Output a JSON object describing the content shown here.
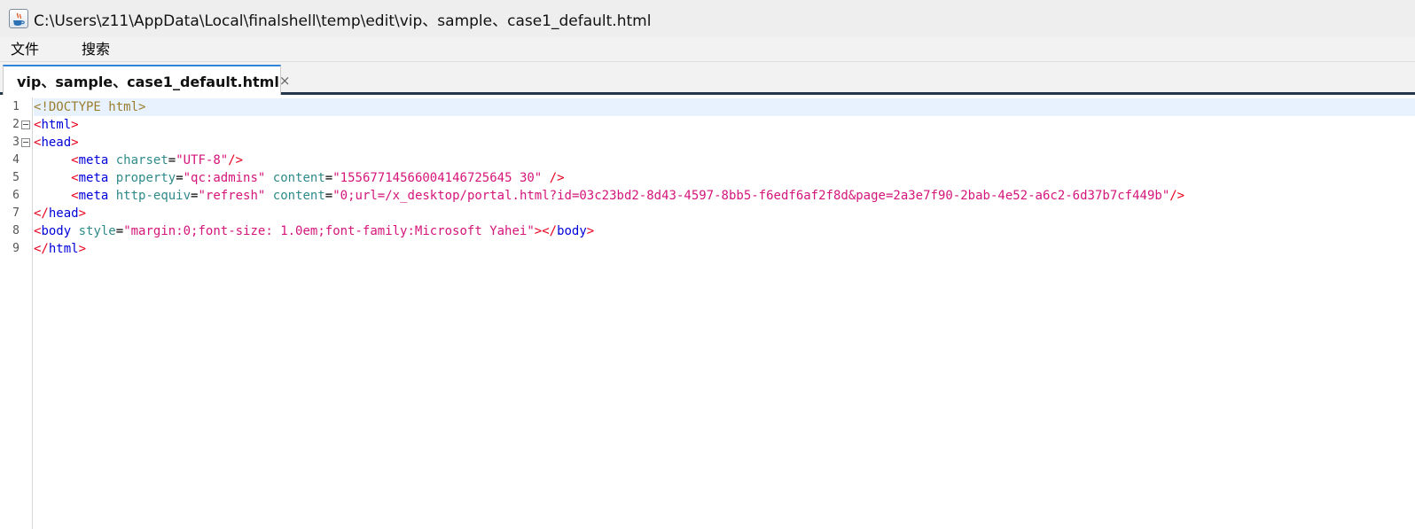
{
  "window": {
    "title": "C:\\Users\\z11\\AppData\\Local\\finalshell\\temp\\edit\\vip、sample、case1_default.html",
    "icon": "java-coffee-cup-icon"
  },
  "menu": {
    "items": [
      {
        "label": "文件"
      },
      {
        "label": "搜索"
      }
    ]
  },
  "tabs": [
    {
      "label": "vip、sample、case1_default.html",
      "close": "×",
      "active": true
    }
  ],
  "colors": {
    "doctype": "#9a7d2e",
    "bracket": "#e8001c",
    "tag": "#0000d8",
    "attr": "#2f8a8a",
    "string": "#d4157a",
    "plain": "#000000",
    "current_line": "#e8f2fe",
    "tab_accent": "#2f86d8"
  },
  "editor": {
    "current_line": 1,
    "lines": [
      {
        "num": "1",
        "fold": false,
        "tokens": [
          {
            "t": "<!DOCTYPE html>",
            "c": "doctype"
          }
        ]
      },
      {
        "num": "2",
        "fold": true,
        "tokens": [
          {
            "t": "<",
            "c": "bracket"
          },
          {
            "t": "html",
            "c": "tag"
          },
          {
            "t": ">",
            "c": "bracket"
          }
        ]
      },
      {
        "num": "3",
        "fold": true,
        "tokens": [
          {
            "t": "<",
            "c": "bracket"
          },
          {
            "t": "head",
            "c": "tag"
          },
          {
            "t": ">",
            "c": "bracket"
          }
        ]
      },
      {
        "num": "4",
        "fold": false,
        "tokens": [
          {
            "t": "     ",
            "c": "plain"
          },
          {
            "t": "<",
            "c": "bracket"
          },
          {
            "t": "meta",
            "c": "tag"
          },
          {
            "t": " ",
            "c": "plain"
          },
          {
            "t": "charset",
            "c": "attr"
          },
          {
            "t": "=",
            "c": "plain"
          },
          {
            "t": "\"UTF-8\"",
            "c": "string"
          },
          {
            "t": "/>",
            "c": "bracket"
          }
        ]
      },
      {
        "num": "5",
        "fold": false,
        "tokens": [
          {
            "t": "     ",
            "c": "plain"
          },
          {
            "t": "<",
            "c": "bracket"
          },
          {
            "t": "meta",
            "c": "tag"
          },
          {
            "t": " ",
            "c": "plain"
          },
          {
            "t": "property",
            "c": "attr"
          },
          {
            "t": "=",
            "c": "plain"
          },
          {
            "t": "\"qc:admins\"",
            "c": "string"
          },
          {
            "t": " ",
            "c": "plain"
          },
          {
            "t": "content",
            "c": "attr"
          },
          {
            "t": "=",
            "c": "plain"
          },
          {
            "t": "\"15567714566004146725645 30\"",
            "c": "string"
          },
          {
            "t": " ",
            "c": "plain"
          },
          {
            "t": "/>",
            "c": "bracket"
          }
        ]
      },
      {
        "num": "6",
        "fold": false,
        "tokens": [
          {
            "t": "     ",
            "c": "plain"
          },
          {
            "t": "<",
            "c": "bracket"
          },
          {
            "t": "meta",
            "c": "tag"
          },
          {
            "t": " ",
            "c": "plain"
          },
          {
            "t": "http-equiv",
            "c": "attr"
          },
          {
            "t": "=",
            "c": "plain"
          },
          {
            "t": "\"refresh\"",
            "c": "string"
          },
          {
            "t": " ",
            "c": "plain"
          },
          {
            "t": "content",
            "c": "attr"
          },
          {
            "t": "=",
            "c": "plain"
          },
          {
            "t": "\"0;url=/x_desktop/portal.html?id=03c23bd2-8d43-4597-8bb5-f6edf6af2f8d&page=2a3e7f90-2bab-4e52-a6c2-6d37b7cf449b\"",
            "c": "string"
          },
          {
            "t": "/>",
            "c": "bracket"
          }
        ]
      },
      {
        "num": "7",
        "fold": false,
        "tokens": [
          {
            "t": "</",
            "c": "bracket"
          },
          {
            "t": "head",
            "c": "tag"
          },
          {
            "t": ">",
            "c": "bracket"
          }
        ]
      },
      {
        "num": "8",
        "fold": false,
        "tokens": [
          {
            "t": "<",
            "c": "bracket"
          },
          {
            "t": "body",
            "c": "tag"
          },
          {
            "t": " ",
            "c": "plain"
          },
          {
            "t": "style",
            "c": "attr"
          },
          {
            "t": "=",
            "c": "plain"
          },
          {
            "t": "\"margin:0;font-size: 1.0em;font-family:Microsoft Yahei\"",
            "c": "string"
          },
          {
            "t": "></",
            "c": "bracket"
          },
          {
            "t": "body",
            "c": "tag"
          },
          {
            "t": ">",
            "c": "bracket"
          }
        ]
      },
      {
        "num": "9",
        "fold": false,
        "tokens": [
          {
            "t": "</",
            "c": "bracket"
          },
          {
            "t": "html",
            "c": "tag"
          },
          {
            "t": ">",
            "c": "bracket"
          }
        ]
      }
    ]
  }
}
